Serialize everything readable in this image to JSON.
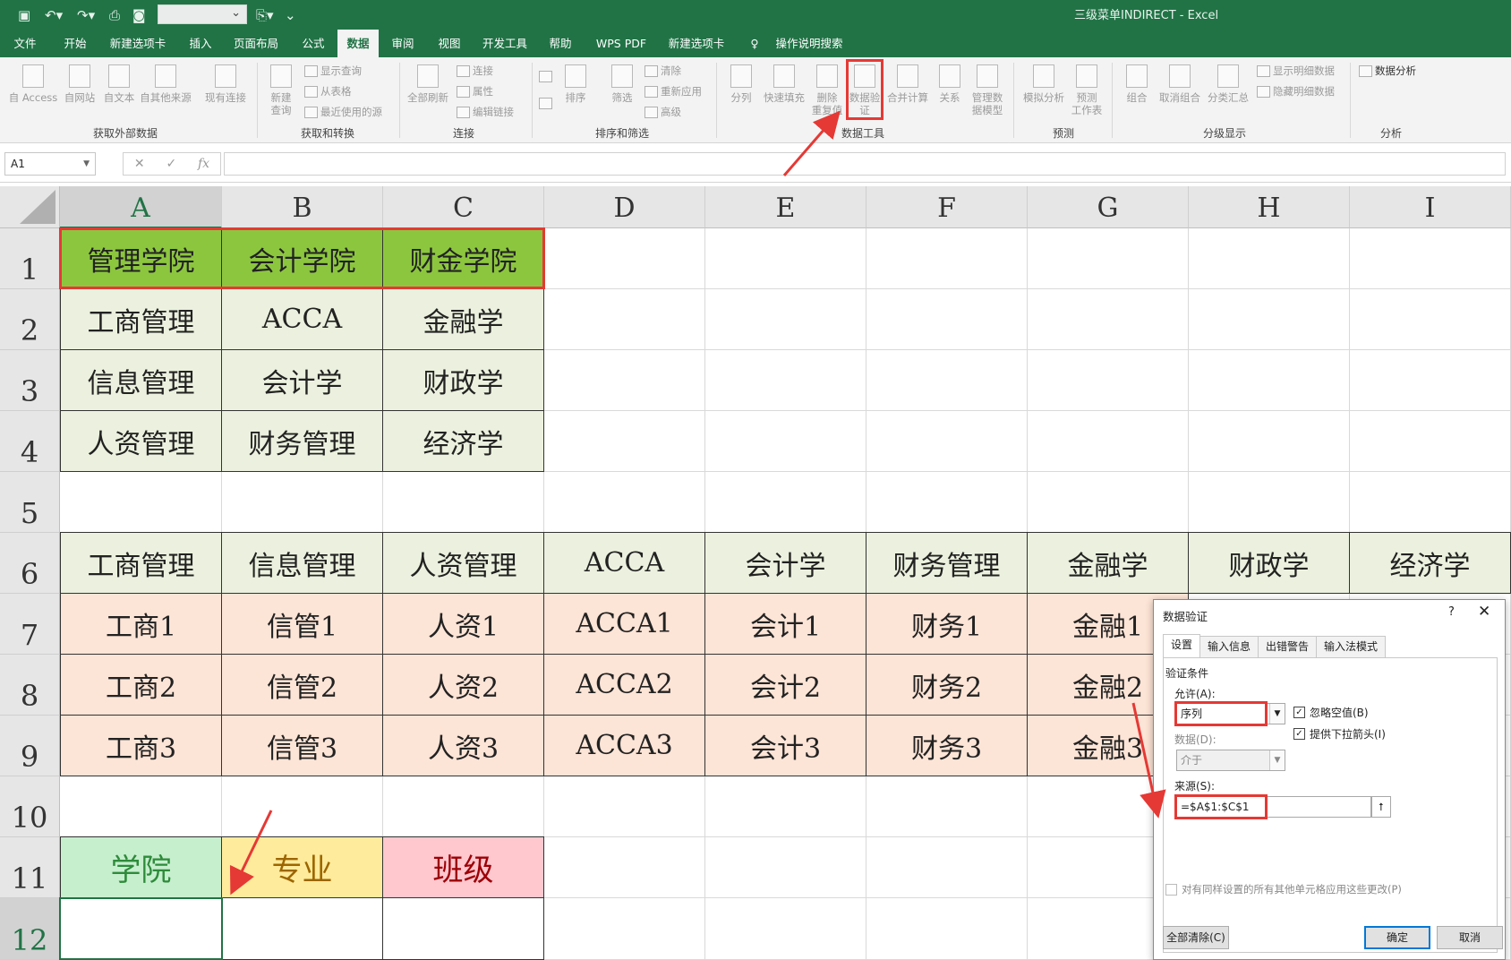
{
  "app": {
    "title": "三级菜单INDIRECT  -  Excel",
    "colors": {
      "brand": "#217346",
      "highlight": "#e53935"
    }
  },
  "quick_access": {
    "undo_icon": "undo-icon",
    "redo_icon": "redo-icon",
    "save_icon": "save-icon"
  },
  "menu": [
    {
      "label": "文件"
    },
    {
      "label": "开始"
    },
    {
      "label": "新建选项卡"
    },
    {
      "label": "插入"
    },
    {
      "label": "页面布局"
    },
    {
      "label": "公式"
    },
    {
      "label": "数据",
      "active": true
    },
    {
      "label": "审阅"
    },
    {
      "label": "视图"
    },
    {
      "label": "开发工具"
    },
    {
      "label": "帮助"
    },
    {
      "label": "WPS PDF"
    },
    {
      "label": "新建选项卡"
    },
    {
      "label": "操作说明搜索"
    }
  ],
  "ribbon": {
    "ext_data": {
      "access": "自 Access",
      "web": "自网站",
      "text": "自文本",
      "other": "自其他来源",
      "existing": "现有连接",
      "group": "获取外部数据"
    },
    "transform": {
      "new_query": "新建\n查询",
      "show_query": "显示查询",
      "from_table": "从表格",
      "recent": "最近使用的源",
      "group": "获取和转换"
    },
    "connections": {
      "refresh_all": "全部刷新",
      "conn": "连接",
      "props": "属性",
      "edit_links": "编辑链接",
      "group": "连接"
    },
    "sort": {
      "sort": "排序",
      "filter": "筛选",
      "clear": "清除",
      "reapply": "重新应用",
      "advanced": "高级",
      "group": "排序和筛选"
    },
    "tools": {
      "split": "分列",
      "flash_fill": "快速填充",
      "remove_dup": "删除\n重复值",
      "validation": "数据验\n证",
      "consolidate": "合并计算",
      "relations": "关系",
      "model": "管理数\n据模型",
      "group": "数据工具"
    },
    "forecast": {
      "whatif": "模拟分析",
      "sheet": "预测\n工作表",
      "group": "预测"
    },
    "outline": {
      "grp": "组合",
      "ungrp": "取消组合",
      "subtotal": "分类汇总",
      "show_detail": "显示明细数据",
      "hide_detail": "隐藏明细数据",
      "group": "分级显示"
    },
    "analysis": {
      "data_analysis": "数据分析",
      "group": "分析"
    }
  },
  "formula_bar": {
    "name_box": "A1",
    "cancel": "✕",
    "enter": "✓",
    "fx": "fx",
    "formula": ""
  },
  "columns": [
    "A",
    "B",
    "C",
    "D",
    "E",
    "F",
    "G",
    "H",
    "I"
  ],
  "rows": [
    "1",
    "2",
    "3",
    "4",
    "5",
    "6",
    "7",
    "8",
    "9",
    "10",
    "11",
    "12"
  ],
  "sheet": {
    "r1": [
      "管理学院",
      "会计学院",
      "财金学院"
    ],
    "r2": [
      "工商管理",
      "ACCA",
      "金融学"
    ],
    "r3": [
      "信息管理",
      "会计学",
      "财政学"
    ],
    "r4": [
      "人资管理",
      "财务管理",
      "经济学"
    ],
    "r6": [
      "工商管理",
      "信息管理",
      "人资管理",
      "ACCA",
      "会计学",
      "财务管理",
      "金融学",
      "财政学",
      "经济学"
    ],
    "r7": [
      "工商1",
      "信管1",
      "人资1",
      "ACCA1",
      "会计1",
      "财务1",
      "金融1"
    ],
    "r8": [
      "工商2",
      "信管2",
      "人资2",
      "ACCA2",
      "会计2",
      "财务2",
      "金融2"
    ],
    "r9": [
      "工商3",
      "信管3",
      "人资3",
      "ACCA3",
      "会计3",
      "财务3",
      "金融3"
    ],
    "r11": [
      "学院",
      "专业",
      "班级"
    ]
  },
  "dialog": {
    "title": "数据验证",
    "help": "?",
    "close": "✕",
    "tabs": [
      "设置",
      "输入信息",
      "出错警告",
      "输入法模式"
    ],
    "criteria_label": "验证条件",
    "allow_label": "允许(A):",
    "allow_value": "序列",
    "ignore_blank": "忽略空值(B)",
    "dropdown": "提供下拉箭头(I)",
    "data_label": "数据(D):",
    "data_value": "介于",
    "source_label": "来源(S):",
    "source_value": "=$A$1:$C$1",
    "apply_all": "对有同样设置的所有其他单元格应用这些更改(P)",
    "clear_all": "全部清除(C)",
    "ok": "确定",
    "cancel": "取消"
  }
}
